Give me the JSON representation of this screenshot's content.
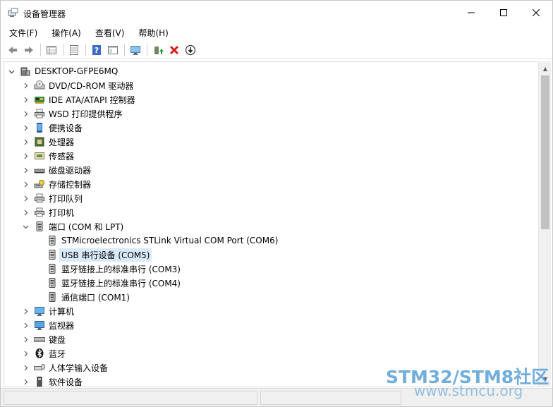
{
  "window": {
    "title": "设备管理器"
  },
  "menu": [
    "文件(F)",
    "操作(A)",
    "查看(V)",
    "帮助(H)"
  ],
  "toolbar": [
    "back-icon",
    "forward-icon",
    "properties-grid-icon",
    "properties-page-icon",
    "help-icon",
    "view-icon",
    "monitor-scan-icon",
    "update-driver-icon",
    "uninstall-icon",
    "disable-icon"
  ],
  "tree": {
    "root": "DESKTOP-GFPE6MQ",
    "items": [
      {
        "label": "DVD/CD-ROM 驱动器",
        "icon": "dvd-icon"
      },
      {
        "label": "IDE ATA/ATAPI 控制器",
        "icon": "ide-controller-icon"
      },
      {
        "label": "WSD 打印提供程序",
        "icon": "printer-icon"
      },
      {
        "label": "便携设备",
        "icon": "portable-device-icon"
      },
      {
        "label": "处理器",
        "icon": "processor-icon"
      },
      {
        "label": "传感器",
        "icon": "sensor-icon"
      },
      {
        "label": "磁盘驱动器",
        "icon": "disk-drive-icon"
      },
      {
        "label": "存储控制器",
        "icon": "storage-controller-icon"
      },
      {
        "label": "打印队列",
        "icon": "print-queue-icon"
      },
      {
        "label": "打印机",
        "icon": "printer-icon"
      },
      {
        "label": "端口 (COM 和 LPT)",
        "icon": "port-icon",
        "expanded": true,
        "children": [
          "STMicroelectronics STLink Virtual COM Port (COM6)",
          "USB 串行设备 (COM5)",
          "蓝牙链接上的标准串行 (COM3)",
          "蓝牙链接上的标准串行 (COM4)",
          "通信端口 (COM1)"
        ]
      },
      {
        "label": "计算机",
        "icon": "computer-icon"
      },
      {
        "label": "监视器",
        "icon": "monitor-icon"
      },
      {
        "label": "键盘",
        "icon": "keyboard-icon"
      },
      {
        "label": "蓝牙",
        "icon": "bluetooth-icon"
      },
      {
        "label": "人体学输入设备",
        "icon": "hid-icon"
      },
      {
        "label": "软件设备",
        "icon": "software-device-icon"
      }
    ],
    "selected": "USB 串行设备 (COM5)"
  },
  "watermark": {
    "line1": "STM32/STM8社区",
    "line2": "www.stmcu.org"
  }
}
